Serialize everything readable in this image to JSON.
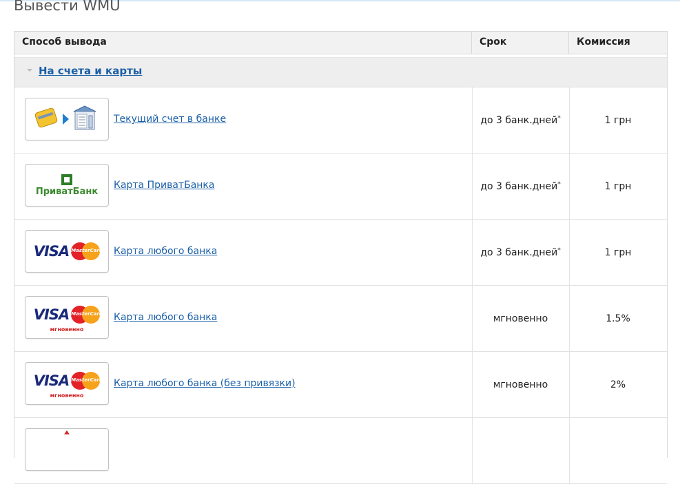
{
  "page": {
    "title": "Вывести WMU"
  },
  "table": {
    "headers": {
      "method": "Способ вывода",
      "term": "Срок",
      "fee": "Комиссия"
    },
    "group": {
      "label": "На счета и карты"
    },
    "rows": [
      {
        "logo": "bank-account-icon",
        "method": "Текущий счет в банке",
        "term": "до 3 банк.дней",
        "term_mark": "*",
        "fee": "1 грн"
      },
      {
        "logo": "privatbank-logo",
        "logo_text": "ПриватБанк",
        "method": "Карта ПриватБанка",
        "term": "до 3 банк.дней",
        "term_mark": "*",
        "fee": "1 грн"
      },
      {
        "logo": "visa-mastercard-logo",
        "logo_text": "VISA",
        "logo_mc": "MasterCard",
        "method": "Карта любого банка",
        "term": "до 3 банк.дней",
        "term_mark": "*",
        "fee": "1 грн"
      },
      {
        "logo": "visa-mastercard-instant-logo",
        "logo_text": "VISA",
        "logo_mc": "MasterCard",
        "logo_sub": "мгновенно",
        "method": "Карта любого банка",
        "term": "мгновенно",
        "term_mark": "",
        "fee": "1.5%"
      },
      {
        "logo": "visa-mastercard-instant-logo",
        "logo_text": "VISA",
        "logo_mc": "MasterCard",
        "logo_sub": "мгновенно",
        "method": "Карта любого банка (без привязки)",
        "term": "мгновенно",
        "term_mark": "",
        "fee": "2%"
      }
    ]
  },
  "colors": {
    "link": "#1a5fa8",
    "header_bg": "#f2f2f2",
    "group_bg": "#eeeeee"
  }
}
